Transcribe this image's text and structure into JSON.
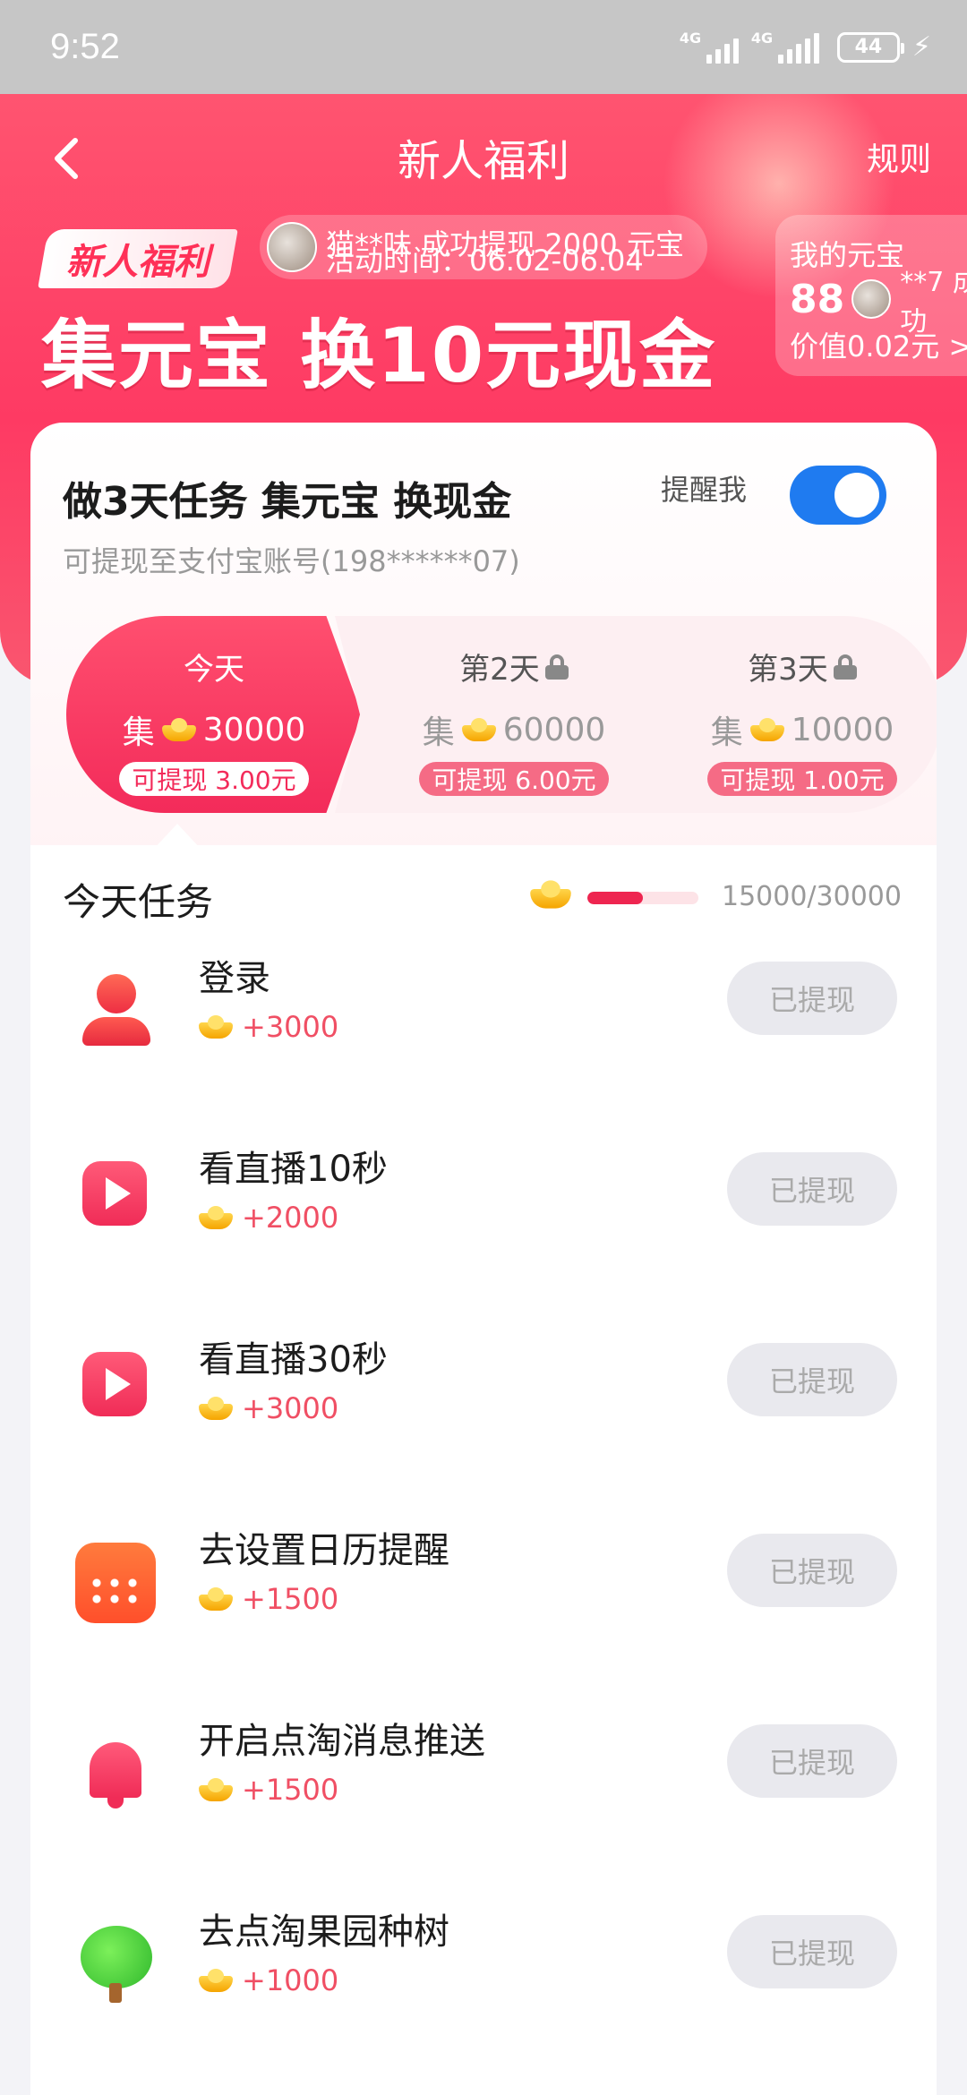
{
  "status_bar": {
    "time": "9:52",
    "net1": "4G",
    "net2": "4G",
    "battery": "44"
  },
  "nav": {
    "title": "新人福利",
    "rules": "规则"
  },
  "hero": {
    "badge": "新人福利",
    "ticker_line1": "猫**味 成功提现 2000 元宝",
    "ticker_line2": "活动时间：06.02-06.04",
    "headline": "集元宝 换10元现金",
    "wallet_title": "我的元宝",
    "wallet_value": "88",
    "wallet_ticker": "**7 成功",
    "wallet_worth": "价值0.02元 >"
  },
  "card": {
    "title": "做3天任务 集元宝 换现金",
    "subtitle": "可提现至支付宝账号(198******07)",
    "remind_label": "提醒我",
    "remind_on": true,
    "days": [
      {
        "label": "今天",
        "collect_prefix": "集",
        "amount": "30000",
        "withdraw": "可提现 3.00元"
      },
      {
        "label": "第2天",
        "collect_prefix": "集",
        "amount": "60000",
        "withdraw": "可提现 6.00元"
      },
      {
        "label": "第3天",
        "collect_prefix": "集",
        "amount": "10000",
        "withdraw": "可提现 1.00元"
      }
    ]
  },
  "tasks": {
    "title": "今天任务",
    "progress_text": "15000/30000",
    "progress_fraction": 0.5,
    "items": [
      {
        "name": "登录",
        "reward": "+3000",
        "button": "已提现",
        "icon": "person-icon"
      },
      {
        "name": "看直播10秒",
        "reward": "+2000",
        "button": "已提现",
        "icon": "play-icon"
      },
      {
        "name": "看直播30秒",
        "reward": "+3000",
        "button": "已提现",
        "icon": "play-icon"
      },
      {
        "name": "去设置日历提醒",
        "reward": "+1500",
        "button": "已提现",
        "icon": "calendar-icon"
      },
      {
        "name": "开启点淘消息推送",
        "reward": "+1500",
        "button": "已提现",
        "icon": "bell-icon"
      },
      {
        "name": "去点淘果园种树",
        "reward": "+1000",
        "button": "已提现",
        "icon": "tree-icon"
      }
    ]
  },
  "colors": {
    "accent": "#fe3a63",
    "toggle": "#1f7bf0"
  }
}
